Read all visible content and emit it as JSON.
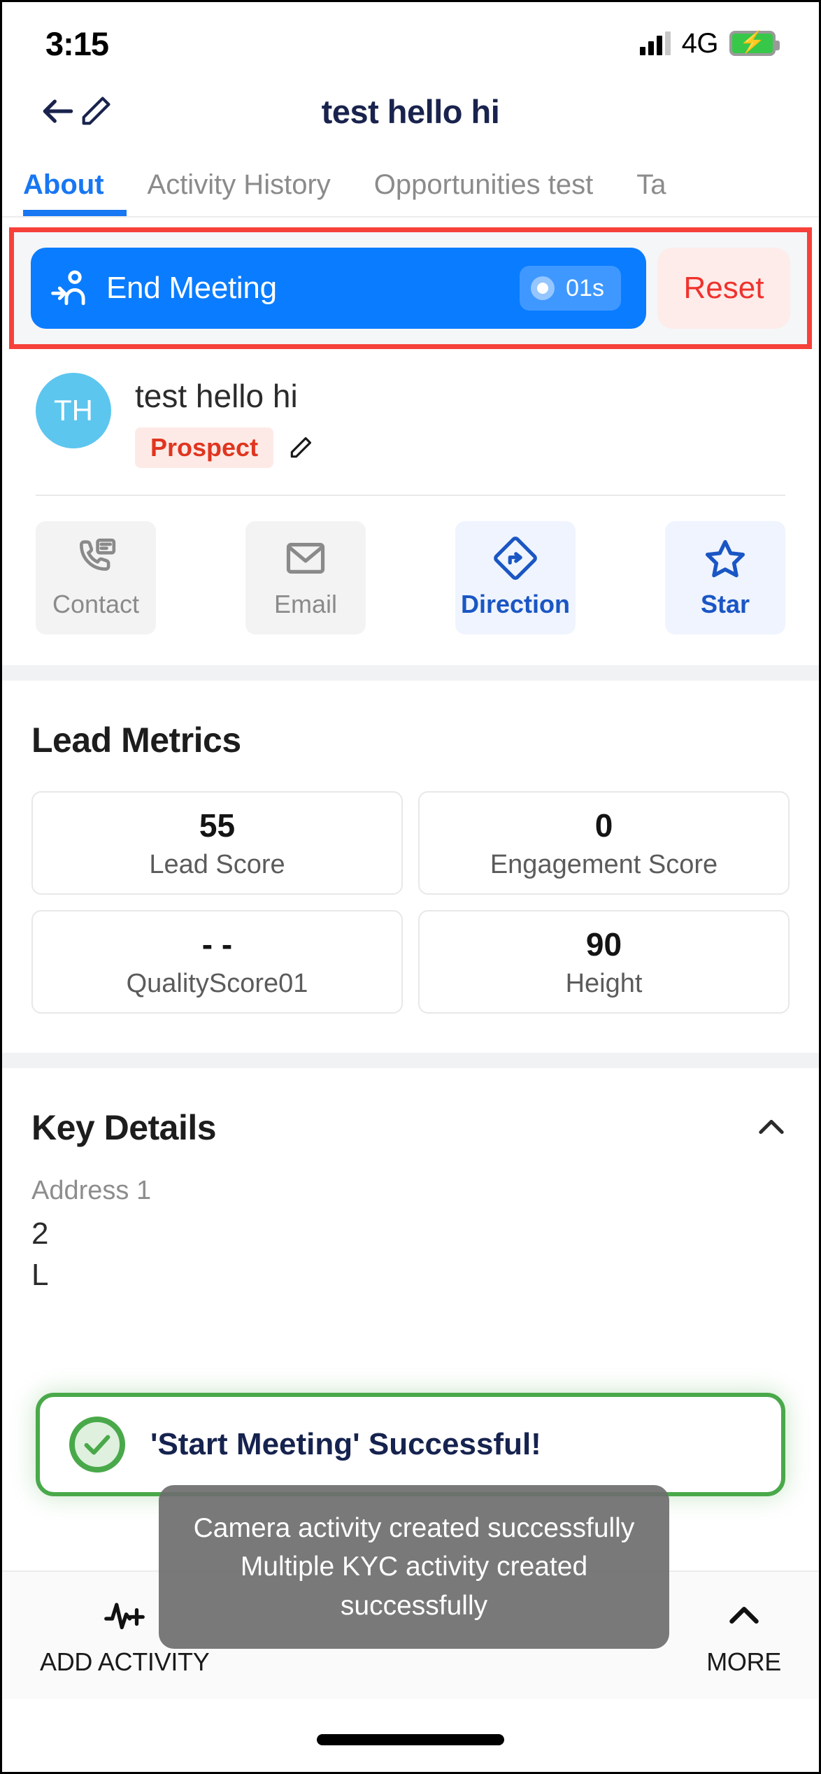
{
  "status_bar": {
    "time": "3:15",
    "network": "4G",
    "signal_icon": "signal-bars-icon",
    "battery_icon": "battery-charging-icon"
  },
  "header": {
    "title": "test hello hi",
    "back_icon": "arrow-left-icon",
    "edit_icon": "pencil-icon"
  },
  "tabs": [
    {
      "label": "About",
      "active": true
    },
    {
      "label": "Activity History",
      "active": false
    },
    {
      "label": "Opportunities test",
      "active": false
    },
    {
      "label": "Ta",
      "active": false
    }
  ],
  "meeting_bar": {
    "highlight_color": "#f6413a",
    "end_meeting_label": "End Meeting",
    "end_meeting_icon": "person-check-in-icon",
    "timer_value": "01s",
    "recording_dot_icon": "record-dot-icon",
    "reset_label": "Reset",
    "button_color": "#0a7cff",
    "reset_text_color": "#f0322c"
  },
  "contact": {
    "avatar_initials": "TH",
    "avatar_color": "#5cc6ef",
    "name": "test hello hi",
    "badge_label": "Prospect",
    "badge_color": "#e0351f",
    "badge_bg": "#fdeae6",
    "edit_icon": "pencil-icon"
  },
  "quick_actions": [
    {
      "label": "Contact",
      "icon": "phone-message-icon",
      "style": "gray"
    },
    {
      "label": "Email",
      "icon": "envelope-icon",
      "style": "gray"
    },
    {
      "label": "Direction",
      "icon": "navigation-diamond-icon",
      "style": "blue"
    },
    {
      "label": "Star",
      "icon": "star-outline-icon",
      "style": "blue"
    }
  ],
  "lead_metrics": {
    "title": "Lead Metrics",
    "items": [
      {
        "value": "55",
        "label": "Lead Score"
      },
      {
        "value": "0",
        "label": "Engagement Score"
      },
      {
        "value": "- -",
        "label": "QualityScore01"
      },
      {
        "value": "90",
        "label": "Height"
      }
    ]
  },
  "key_details": {
    "title": "Key Details",
    "collapse_icon": "chevron-up-icon",
    "fields": [
      {
        "label": "Address 1",
        "value": "2\nL"
      }
    ]
  },
  "success_toast": {
    "message": "'Start Meeting' Successful!",
    "icon": "check-circle-icon",
    "border_color": "#49a94a",
    "text_color": "#16234f"
  },
  "bottom_bar": {
    "add_activity_label": "ADD ACTIVITY",
    "add_activity_icon": "pulse-plus-icon",
    "more_label": "MORE",
    "more_icon": "chevron-up-icon"
  },
  "gray_toast": {
    "line1": "Camera activity created successfully",
    "line2": "Multiple KYC activity created successfully"
  }
}
